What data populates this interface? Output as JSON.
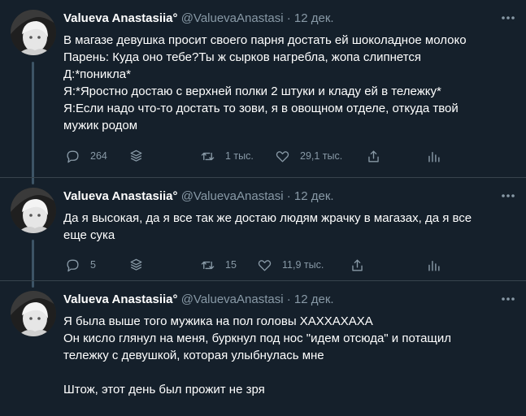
{
  "author": {
    "name": "Valueva Anastasiia",
    "suffix": "°",
    "handle": "@ValuevaAnastasi",
    "separator": "·"
  },
  "tweets": [
    {
      "date": "12 дек.",
      "lines": [
        "В магазе девушка просит своего парня достать ей шоколадное молоко",
        "Парень: Куда оно тебе?Ты ж сырков нагребла, жопа слипнется",
        "Д:*поникла*",
        "Я:*Яростно достаю с верхней полки 2 штуки и кладу ей в тележку*",
        "Я:Если надо что-то достать то зови, я в овощном отделе, откуда твой",
        "мужик родом"
      ],
      "replies": "264",
      "retweets": "1 тыс.",
      "likes": "29,1 тыс."
    },
    {
      "date": "12 дек.",
      "lines": [
        "Да я высокая, да я все так же достаю людям жрачку в магазах, да я все",
        "еще сука"
      ],
      "replies": "5",
      "retweets": "15",
      "likes": "11,9 тыс."
    },
    {
      "date": "12 дек.",
      "lines": [
        "Я была выше того мужика на пол головы ХАХХАХАХА",
        "Он кисло глянул на меня, буркнул под нос \"идем отсюда\" и потащил",
        "тележку с девушкой, которая улыбнулась мне",
        "",
        "Штож, этот день был прожит не зря"
      ]
    }
  ],
  "icons": {
    "more": "more-dots-icon",
    "reply": "reply-bubble-icon",
    "thread": "stack-icon",
    "retweet": "retweet-icon",
    "like": "heart-icon",
    "share": "share-icon",
    "analytics": "bar-chart-icon"
  },
  "colors": {
    "background": "#15202b",
    "text": "#ffffff",
    "secondary": "#8899a6",
    "separator": "#38444d"
  }
}
